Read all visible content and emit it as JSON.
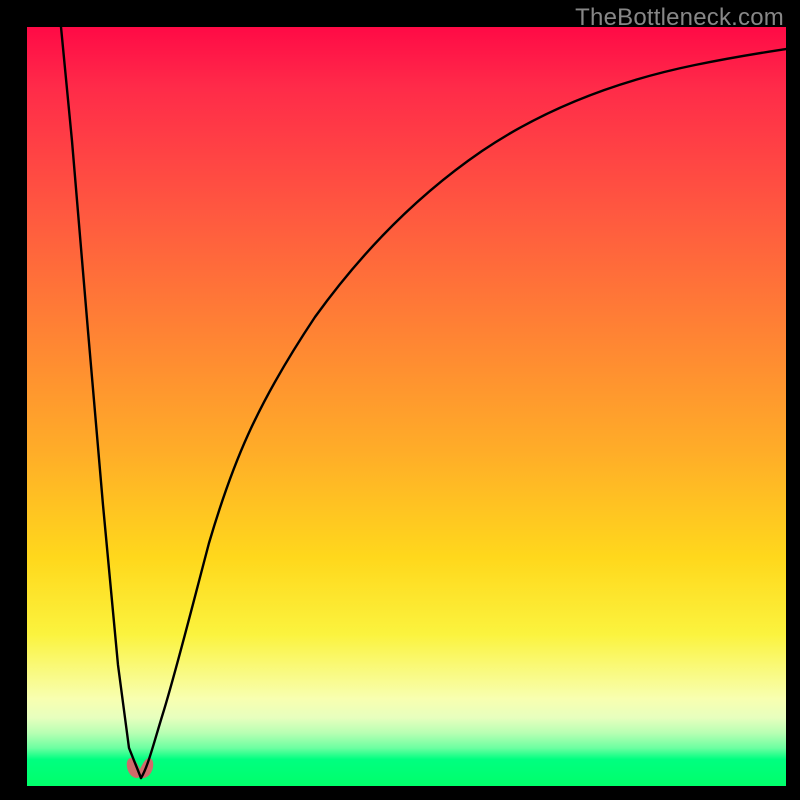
{
  "watermark": "TheBottleneck.com",
  "chart_data": {
    "type": "line",
    "title": "",
    "xlabel": "",
    "ylabel": "",
    "xlim": [
      0,
      100
    ],
    "ylim": [
      0,
      100
    ],
    "grid": false,
    "background_gradient": {
      "orientation": "vertical",
      "stops": [
        {
          "pos": 0,
          "color": "#ff0a46"
        },
        {
          "pos": 24,
          "color": "#ff5740"
        },
        {
          "pos": 56,
          "color": "#ffad28"
        },
        {
          "pos": 80,
          "color": "#fbf33e"
        },
        {
          "pos": 92,
          "color": "#d0ffb8"
        },
        {
          "pos": 100,
          "color": "#00ff6a"
        }
      ]
    },
    "series": [
      {
        "name": "bottleneck-curve",
        "description": "Two-branch curve that plunges from the top-left to a minimum near x≈15 then rises asymptotically toward the top as x increases",
        "x": [
          4.5,
          6,
          8,
          10,
          12,
          13.5,
          15,
          16.5,
          18,
          20,
          24,
          30,
          38,
          48,
          60,
          74,
          88,
          100
        ],
        "y": [
          100,
          85,
          60,
          37,
          16,
          5,
          1,
          3,
          10,
          22,
          40,
          56,
          68,
          77,
          84,
          89,
          92.3,
          94.7
        ]
      }
    ],
    "marker": {
      "name": "min-marker",
      "shape": "pink-blob",
      "x": 15,
      "y": 1,
      "color": "#d06a6a"
    }
  },
  "colors": {
    "frame": "#000000",
    "curve": "#000000",
    "blob": "#d06a6a",
    "watermark": "#878787"
  }
}
